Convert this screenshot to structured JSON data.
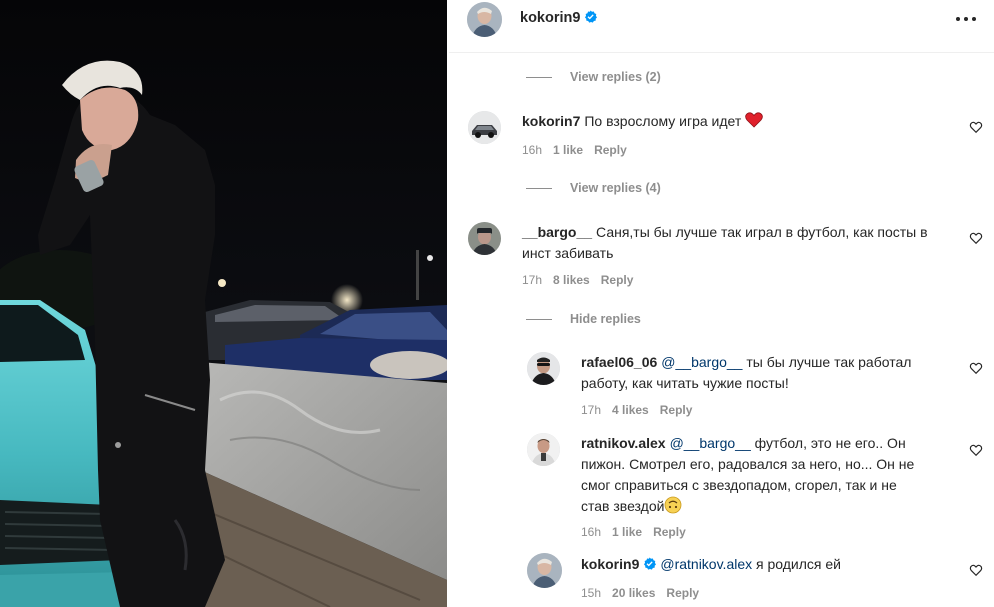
{
  "post": {
    "author": "kokorin9",
    "verified": true,
    "avatar_icon": "profile-photo"
  },
  "comments": [
    {
      "id": "c0",
      "view_replies_above": "View replies (2)"
    },
    {
      "id": "c1",
      "username": "kokorin7",
      "text": "По взрослому игра идет",
      "emoji": "red-heart",
      "time": "16h",
      "likes": "1 like",
      "reply_label": "Reply",
      "view_replies": "View replies (4)"
    },
    {
      "id": "c2",
      "username": "__bargo__",
      "text_line1": "Саня,ты бы лучше так играл в футбол, как посты в",
      "text_line2": "инст забивать",
      "time": "17h",
      "likes": "8 likes",
      "reply_label": "Reply",
      "hide_replies": "Hide replies",
      "replies": [
        {
          "id": "r1",
          "username": "rafael06_06",
          "mention": "@__bargo__",
          "text_line1": "ты бы лучше так работал",
          "text_line2": "работу, как читать чужие посты!",
          "time": "17h",
          "likes": "4 likes",
          "reply_label": "Reply"
        },
        {
          "id": "r2",
          "username": "ratnikov.alex",
          "mention": "@__bargo__",
          "text_line1": "футбол, это не его.. Он",
          "text_line2": "пижон. Смотрел его, радовался за него, но... Он не",
          "text_line3": "смог справиться с звездопадом, сгорел, так и не",
          "text_line4": "став звездой",
          "emoji": "upside-down-face",
          "time": "16h",
          "likes": "1 like",
          "reply_label": "Reply"
        },
        {
          "id": "r3",
          "username": "kokorin9",
          "verified": true,
          "mention": "@ratnikov.alex",
          "text": "я родился ей",
          "time": "15h",
          "likes": "20 likes",
          "reply_label": "Reply"
        }
      ]
    }
  ],
  "colors": {
    "text": "#262626",
    "secondary": "#8e8e8e",
    "mention": "#00376b",
    "verified": "#0095f6",
    "heart_red": "#ed4956",
    "car_teal": "#4fc2c8"
  }
}
